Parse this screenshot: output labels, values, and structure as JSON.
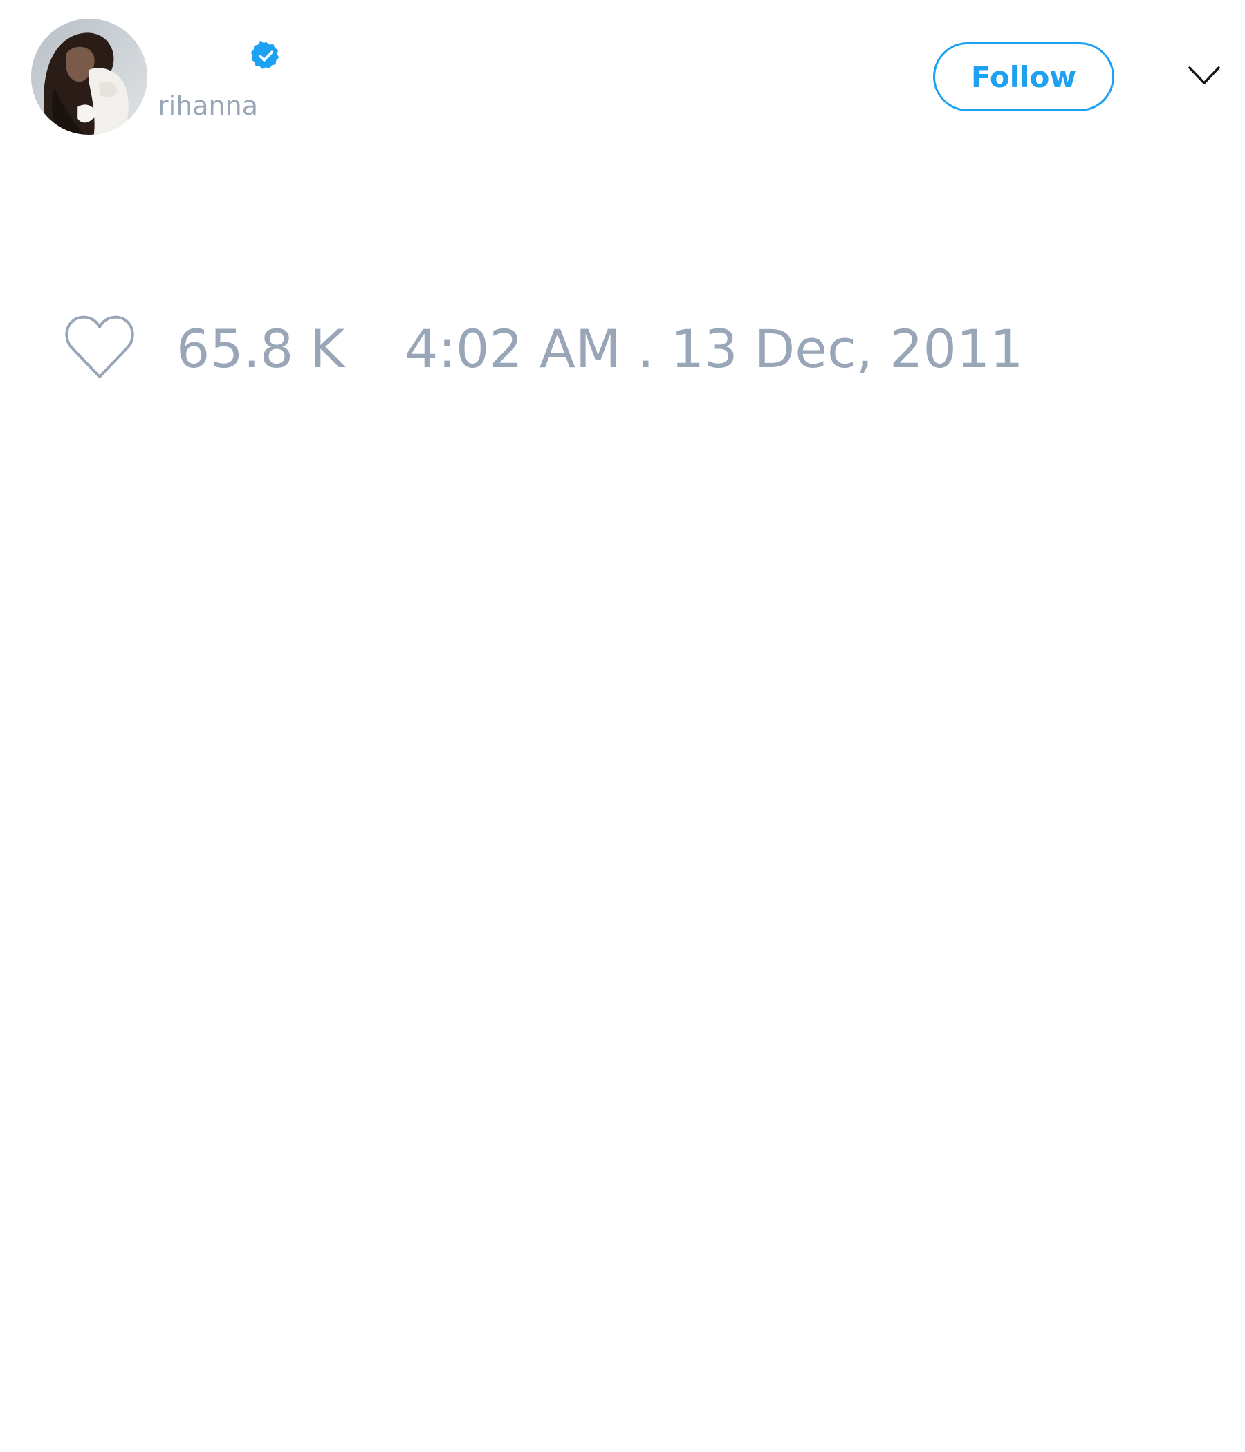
{
  "profile": {
    "handle": "rihanna",
    "verified": true,
    "avatar_icon": "profile-photo",
    "verified_icon": "verified-badge-icon",
    "verified_color": "#1da1f2"
  },
  "actions": {
    "follow_label": "Follow",
    "more_icon": "chevron-down-icon"
  },
  "stats": {
    "like_icon": "heart-outline-icon",
    "likes": "65.8 K",
    "timestamp": "4:02 AM . 13 Dec, 2011"
  },
  "colors": {
    "accent": "#1da1f2",
    "muted_text": "#98a6b8",
    "background": "#ffffff"
  }
}
